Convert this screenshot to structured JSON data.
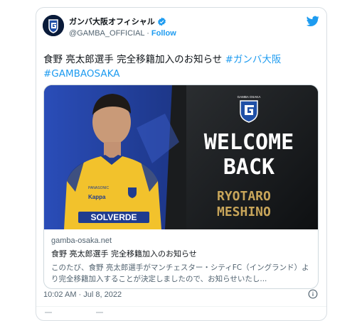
{
  "account": {
    "display_name": "ガンバ大阪オフィシャル",
    "handle": "@GAMBA_OFFICIAL",
    "separator": "·",
    "follow_label": "Follow"
  },
  "tweet": {
    "text_main": "食野 亮太郎選手 完全移籍加入のお知らせ ",
    "hashtag_1": "#ガンバ大阪",
    "hashtag_2": "#GAMBAOSAKA",
    "timestamp": "10:02 AM · Jul 8, 2022"
  },
  "card": {
    "image": {
      "headline_line1": "WELCOME",
      "headline_line2": "BACK",
      "player_line1": "RYOTARO",
      "player_line2": "MESHINO",
      "sponsor": "SOLVERDE",
      "brand": "Kappa",
      "crest_text": "GAMBA OSAKA",
      "chest_small": "PANASONIC"
    },
    "domain": "gamba-osaka.net",
    "title": "食野 亮太郎選手 完全移籍加入のお知らせ",
    "description": "このたび、食野 亮太郎選手がマンチェスター・シティFC（イングランド）より完全移籍加入することが決定しましたので、お知らせいたし..."
  },
  "colors": {
    "link_blue": "#1d9bf0",
    "jersey_yellow": "#f2c22c",
    "club_blue": "#1f3c8f",
    "headline_white": "#ffffff",
    "player_gold": "#c8a55a"
  },
  "icons": [
    "verified-badge-icon",
    "twitter-bird-icon",
    "info-icon",
    "club-crest-icon"
  ]
}
